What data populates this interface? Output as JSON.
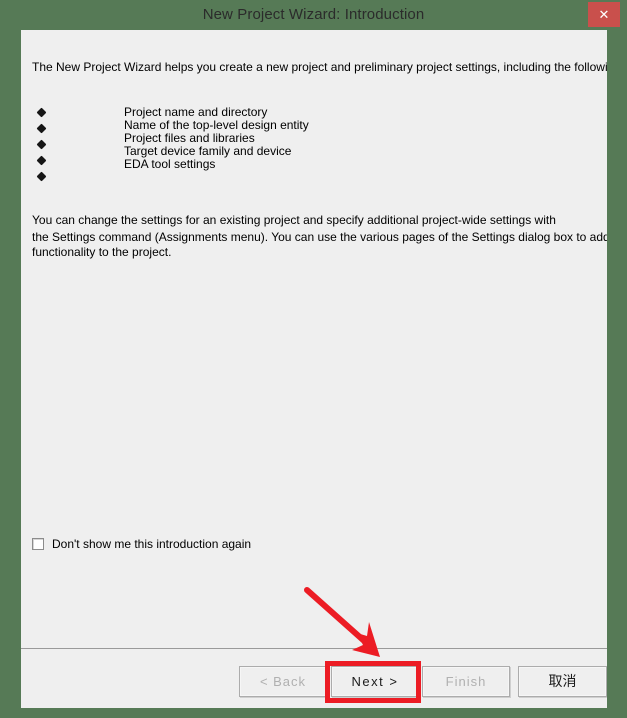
{
  "window": {
    "title": "New Project Wizard: Introduction",
    "frame_color": "#567a56",
    "client_bg": "#efefef",
    "close_button": {
      "icon": "close-icon",
      "glyph": "✕",
      "color": "#c9504c"
    }
  },
  "content": {
    "intro": "The New Project Wizard helps you create a new project and preliminary project settings, including the following:",
    "bullets": [
      "Project name and directory",
      "Name of the top-level design entity",
      "Project files and libraries",
      "Target device family and device",
      "EDA tool settings"
    ],
    "bullet_marker_count": 5,
    "paragraph": [
      "You can change the settings for an existing project and specify additional project-wide settings with",
      "the Settings command (Assignments menu). You can use the various pages of the Settings dialog box to add",
      "functionality to the project."
    ]
  },
  "checkbox": {
    "label": "Don't show me this introduction again",
    "checked": false
  },
  "buttons": {
    "back": {
      "label": "< Back",
      "enabled": false
    },
    "next": {
      "label": "Next >",
      "enabled": true
    },
    "finish": {
      "label": "Finish",
      "enabled": false
    },
    "cancel": {
      "label": "取消",
      "enabled": true
    }
  },
  "annotations": {
    "color": "#ec1c24",
    "highlight_target": "next-button",
    "arrow": "points down-right to Next button"
  }
}
